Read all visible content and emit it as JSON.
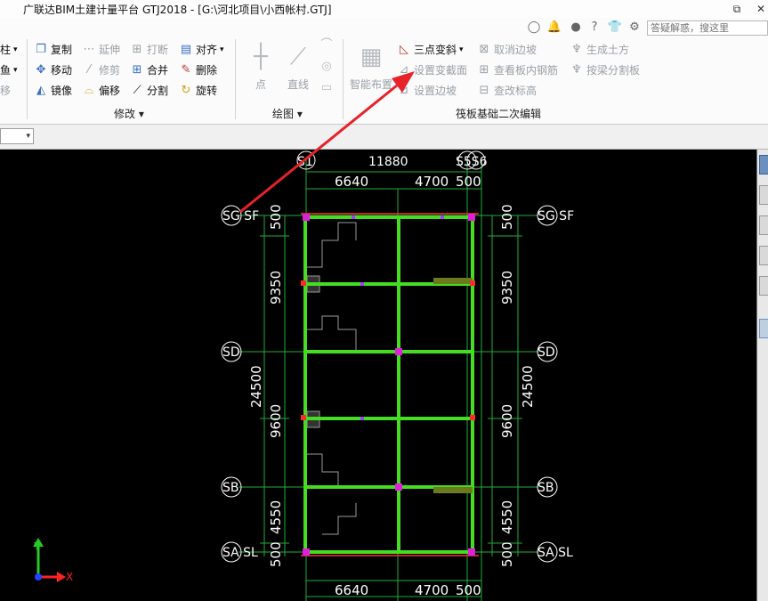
{
  "app": {
    "title": "广联达BIM土建计量平台 GTJ2018 - [G:\\河北项目\\小西帐村.GTJ]",
    "search_placeholder": "答疑解惑，搜这里"
  },
  "window_controls": {
    "restore": "⧉",
    "close": "✕"
  },
  "ribbon": {
    "left_cut": {
      "item1": "柱",
      "item2": "鱼",
      "item3": "移"
    },
    "modify": {
      "label": "修改",
      "copy": "复制",
      "extend": "延伸",
      "break": "打断",
      "align": "对齐",
      "move": "移动",
      "trim": "修剪",
      "merge": "合并",
      "delete": "删除",
      "mirror": "镜像",
      "offset": "偏移",
      "split": "分割",
      "rotate": "旋转"
    },
    "draw": {
      "label": "绘图",
      "point": "点",
      "line": "直线"
    },
    "raft": {
      "label": "筏板基础二次编辑",
      "smart_layout_1": "智能布置",
      "three_point_slope": "三点变斜",
      "set_variable_section": "设置变截面",
      "set_edge_slope": "设置边坡",
      "cancel_edge_slope": "取消边坡",
      "view_rebar": "查看板内钢筋",
      "modify_elevation": "查改标高",
      "generate_earthwork": "生成土方",
      "split_by_beam": "按梁分割板"
    }
  },
  "icons": {
    "avatar": "person-icon",
    "bell": "bell-icon",
    "chat": "chat-icon",
    "help": "help-icon",
    "shirt": "shirt-icon"
  },
  "canvas": {
    "axes_top": [
      "S1",
      "11880",
      "S5S6"
    ],
    "axes_left": [
      "SG\nSF",
      "SD",
      "SB",
      "SA\nSL"
    ],
    "axes_right": [
      "SG\nSF",
      "SD",
      "SB",
      "SA\nSL"
    ],
    "dims_top": [
      "6640",
      "4700",
      "500"
    ],
    "dims_bottom": [
      "6640",
      "4700",
      "500"
    ],
    "dims_left_outer": [
      "500",
      "9350",
      "9600",
      "4550",
      "500"
    ],
    "dims_left_total": "24500",
    "dims_right_outer": [
      "500",
      "9350",
      "9600",
      "4550",
      "500"
    ],
    "dims_right_total": "24500",
    "axis_x_label": "X",
    "axis_y_label": "Y"
  }
}
